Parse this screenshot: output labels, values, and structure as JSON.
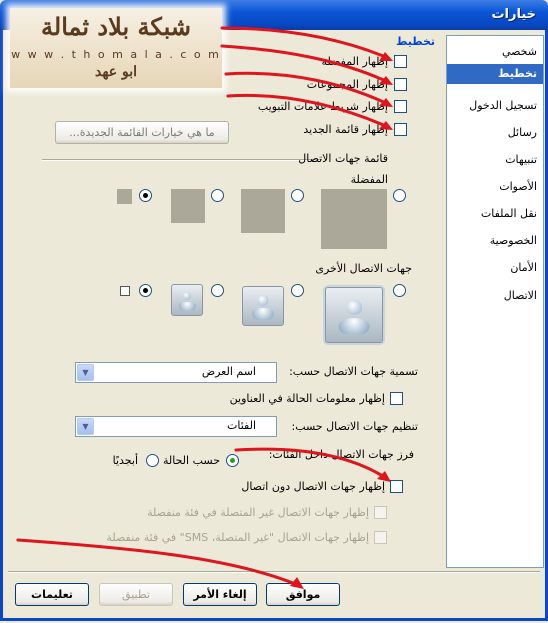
{
  "window": {
    "title": "خيارات"
  },
  "logo": {
    "line1": "شبكة بلاد ثمالة",
    "line2": "w w w . t h o m a l a . c o m",
    "line3": "ابو عهد"
  },
  "nav": {
    "items": [
      {
        "label": "شخصي"
      },
      {
        "label": "تخطيط",
        "selected": true
      },
      {
        "label": "تسجيل الدخول"
      },
      {
        "label": "رسائل"
      },
      {
        "label": "تنبيهات"
      },
      {
        "label": "الأصوات"
      },
      {
        "label": "نقل الملفات"
      },
      {
        "label": "الخصوصية"
      },
      {
        "label": "الأمان"
      },
      {
        "label": "الاتصال"
      }
    ]
  },
  "layout": {
    "section_title": "تخطيط",
    "checkboxes": [
      {
        "label": "إظهار المفضلة",
        "checked": false
      },
      {
        "label": "إظهار المجموعات",
        "checked": false
      },
      {
        "label": "إظهار شريط علامات التبويب",
        "checked": false
      },
      {
        "label": "إظهار قائمة الجديد",
        "checked": false
      }
    ],
    "whats_new_button": "ما هي خيارات القائمة الجديدة...",
    "contact_list_heading": "قائمة جهات الاتصال",
    "favorites_label": "المفضلة",
    "other_contacts_label": "جهات الاتصال الأخرى",
    "naming_label": "تسمية جهات الاتصال حسب:",
    "naming_value": "اسم العرض",
    "show_status_label": "إظهار معلومات الحالة في العناوين",
    "organize_label": "تنظيم جهات الاتصال حسب:",
    "organize_value": "الفئات",
    "sort_label": "فرز جهات الاتصال داخل الفئات:",
    "sort_by_status": "حسب الحالة",
    "sort_alpha": "أبجديًا",
    "show_offline_label": "إظهار جهات الاتصال دون اتصال",
    "offline_separate_label": "إظهار جهات الاتصال غير المتصلة في فئة منفصلة",
    "sms_separate_label": "إظهار جهات الاتصال \"غير المتصلة، SMS\" في فئة منفصلة"
  },
  "footer": {
    "ok": "موافق",
    "cancel": "إلغاء الأمر",
    "apply": "تطبيق",
    "help": "تعليمات"
  },
  "colors": {
    "titlebar": "#0a56d6",
    "accent": "#316ac5",
    "annotation": "#e0141c"
  }
}
